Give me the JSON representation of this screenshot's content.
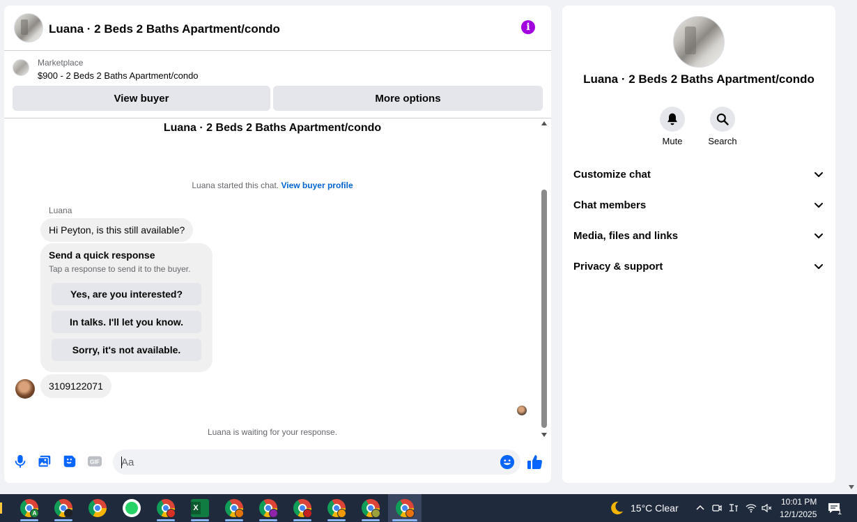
{
  "chat": {
    "header_title": "Luana · 2 Beds 2 Baths Apartment/condo",
    "info_glyph": "i",
    "listing_source": "Marketplace",
    "listing_price": "$900 - 2 Beds 2 Baths Apartment/condo",
    "view_buyer_label": "View buyer",
    "more_options_label": "More options",
    "conversation_title": "Luana · 2 Beds 2 Baths Apartment/condo",
    "started_text": "Luana started this chat.",
    "view_buyer_profile_link": "View buyer profile",
    "sender_name": "Luana",
    "message_1": "Hi Peyton, is this still available?",
    "quick_response": {
      "title": "Send a quick response",
      "subtitle": "Tap a response to send it to the buyer.",
      "options": [
        "Yes, are you interested?",
        "In talks. I'll let you know.",
        "Sorry, it's not available."
      ]
    },
    "message_2": "3109122071",
    "waiting_text": "Luana is waiting for your response.",
    "composer_placeholder": "Aa",
    "gif_label": "GIF",
    "accent_color": "#0866ff",
    "info_color": "#a300e0"
  },
  "details": {
    "title": "Luana · 2 Beds 2 Baths Apartment/condo",
    "actions": [
      {
        "label": "Mute",
        "icon": "bell-icon"
      },
      {
        "label": "Search",
        "icon": "search-icon"
      }
    ],
    "sections": [
      "Customize chat",
      "Chat members",
      "Media, files and links",
      "Privacy & support"
    ]
  },
  "taskbar": {
    "weather": "15°C  Clear",
    "time": "10:01 PM",
    "date": "12/1/2025",
    "notification_count": "1",
    "excel_letter": "X",
    "badge_letter": "A"
  }
}
